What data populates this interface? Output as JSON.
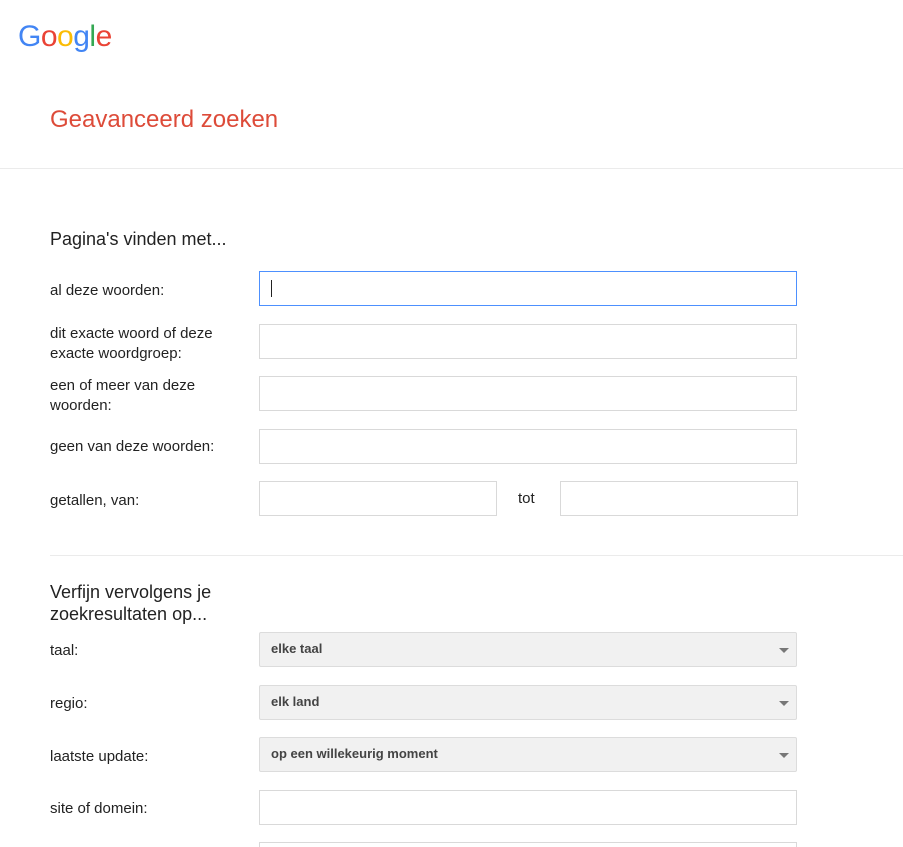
{
  "logo": {
    "letters": [
      {
        "char": "G",
        "color": "#4285f4"
      },
      {
        "char": "o",
        "color": "#ea4335"
      },
      {
        "char": "o",
        "color": "#fbbc05"
      },
      {
        "char": "g",
        "color": "#4285f4"
      },
      {
        "char": "l",
        "color": "#34a853"
      },
      {
        "char": "e",
        "color": "#ea4335"
      }
    ]
  },
  "page_title": "Geavanceerd zoeken",
  "section_find": {
    "title": "Pagina's vinden met...",
    "all_words_label": "al deze woorden:",
    "exact_label": "dit exacte woord of deze exacte woordgroep:",
    "any_label": "een of meer van deze woorden:",
    "none_label": "geen van deze woorden:",
    "numbers_label": "getallen, van:",
    "numbers_to": "tot"
  },
  "section_refine": {
    "title": "Verfijn vervolgens je zoekresultaten op...",
    "language_label": "taal:",
    "language_value": "elke taal",
    "region_label": "regio:",
    "region_value": "elk land",
    "update_label": "laatste update:",
    "update_value": "op een willekeurig moment",
    "site_label": "site of domein:"
  },
  "colors": {
    "title_red": "#dd4b39",
    "focus_blue": "#4d90fe"
  }
}
